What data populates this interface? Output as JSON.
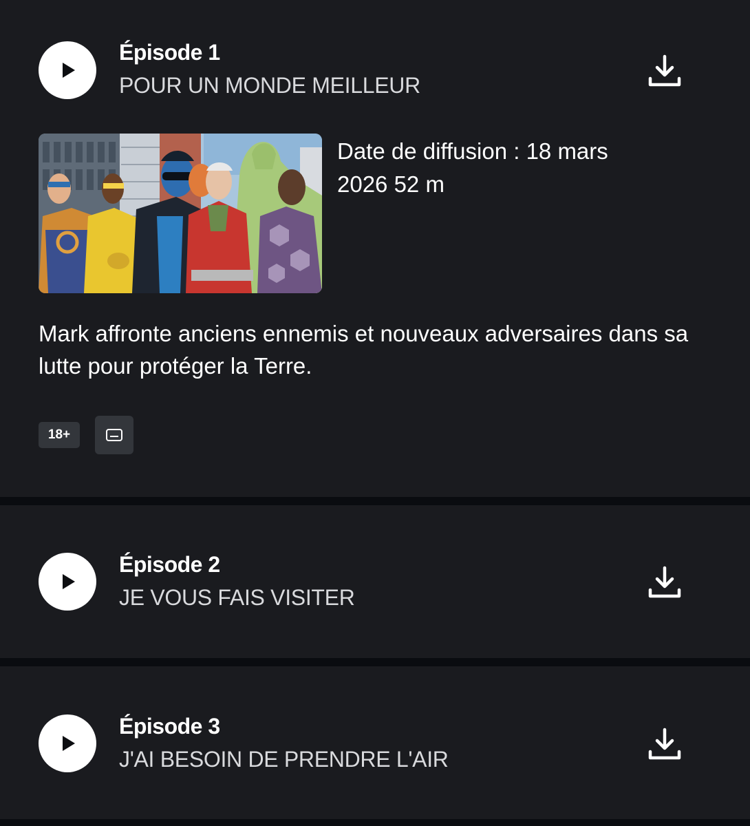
{
  "episodes": [
    {
      "number": "Épisode 1",
      "title": "POUR UN MONDE MEILLEUR",
      "meta": "Date de diffusion : 18 mars 2026 52 m",
      "description": "Mark affronte anciens ennemis et nouveaux adversaires dans sa lutte pour protéger la Terre.",
      "rating": "18+",
      "play_icon": "play-icon",
      "download_icon": "download-icon",
      "subtitles_icon": "subtitles-icon"
    },
    {
      "number": "Épisode 2",
      "title": "JE VOUS FAIS VISITER",
      "play_icon": "play-icon",
      "download_icon": "download-icon"
    },
    {
      "number": "Épisode 3",
      "title": "J'AI BESOIN DE PRENDRE L'AIR",
      "play_icon": "play-icon",
      "download_icon": "download-icon"
    }
  ],
  "colors": {
    "background": "#0a0c10",
    "card": "#1a1b1f",
    "badge": "#33363b",
    "text": "#ffffff",
    "subtitle_text": "#d9dadd"
  }
}
